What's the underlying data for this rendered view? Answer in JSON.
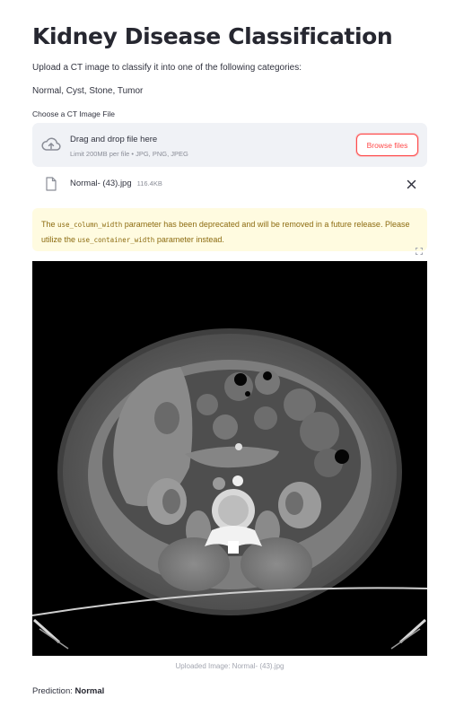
{
  "page": {
    "title": "Kidney Disease Classification",
    "intro": "Upload a CT image to classify it into one of the following categories:",
    "categories_text": "Normal, Cyst, Stone, Tumor"
  },
  "uploader": {
    "label": "Choose a CT Image File",
    "drag_text": "Drag and drop file here",
    "limit_text": "Limit 200MB per file • JPG, PNG, JPEG",
    "browse_label": "Browse files",
    "icon": "cloud-upload-icon"
  },
  "file": {
    "name": "Normal- (43).jpg",
    "size": "116.4KB",
    "icon": "file-icon"
  },
  "warning": {
    "part1": "The ",
    "code1": "use_column_width",
    "part2": " parameter has been deprecated and will be removed in a future release. Please utilize the ",
    "code2": "use_container_width",
    "part3": " parameter instead."
  },
  "image": {
    "caption": "Uploaded Image: Normal- (43).jpg"
  },
  "result": {
    "label": "Prediction: ",
    "value": "Normal"
  },
  "colors": {
    "accent": "#ff4b4b",
    "warning_bg": "#fffbe0",
    "warning_text": "#8c6b10",
    "dropzone_bg": "#f0f2f6"
  }
}
